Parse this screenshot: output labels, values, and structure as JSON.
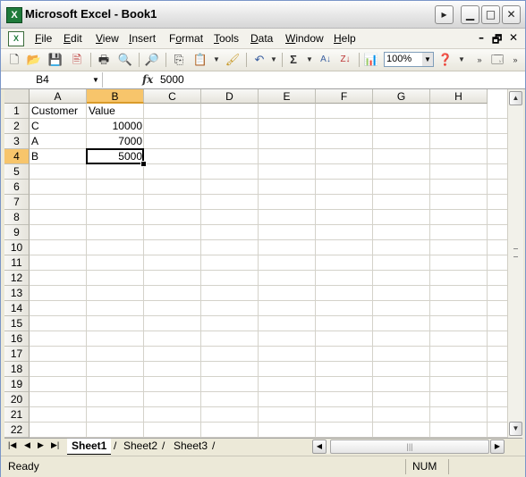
{
  "window": {
    "title": "Microsoft Excel - Book1"
  },
  "menu": [
    "File",
    "Edit",
    "View",
    "Insert",
    "Format",
    "Tools",
    "Data",
    "Window",
    "Help"
  ],
  "menu_accel": [
    "F",
    "E",
    "V",
    "I",
    "o",
    "T",
    "D",
    "W",
    "H"
  ],
  "toolbar": {
    "zoom": "100%"
  },
  "formula_bar": {
    "name_box": "B4",
    "fx_label": "fx",
    "formula": "5000"
  },
  "columns": [
    "A",
    "B",
    "C",
    "D",
    "E",
    "F",
    "G",
    "H"
  ],
  "rows": [
    "1",
    "2",
    "3",
    "4",
    "5",
    "6",
    "7",
    "8",
    "9",
    "10",
    "11",
    "12",
    "13",
    "14",
    "15",
    "16",
    "17",
    "18",
    "19",
    "20",
    "21",
    "22"
  ],
  "cells": {
    "A1": "Customer",
    "B1": "Value",
    "A2": "C",
    "B2": "10000",
    "A3": "A",
    "B3": "7000",
    "A4": "B",
    "B4": "5000"
  },
  "sheets": [
    "Sheet1",
    "Sheet2",
    "Sheet3"
  ],
  "active_sheet": "Sheet1",
  "status": {
    "left": "Ready",
    "num": "NUM"
  },
  "colors": {
    "selection_header": "#f7c56b",
    "title_bar": "#e8e8e8"
  }
}
